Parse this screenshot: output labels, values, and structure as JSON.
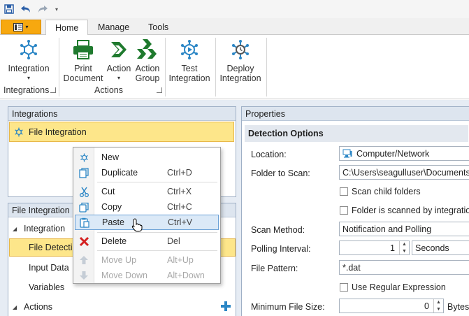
{
  "ribbon_tabs": [
    {
      "label": "Home",
      "active": true
    },
    {
      "label": "Manage",
      "active": false
    },
    {
      "label": "Tools",
      "active": false
    }
  ],
  "ribbon": {
    "integration": {
      "line1": "Integration",
      "dropdown": true
    },
    "integrations_group": "Integrations",
    "print": {
      "line1": "Print",
      "line2": "Document"
    },
    "action": {
      "line1": "Action",
      "dropdown": true
    },
    "action_group": {
      "line1": "Action",
      "line2": "Group"
    },
    "actions_group": "Actions",
    "test": {
      "line1": "Test",
      "line2": "Integration"
    },
    "deploy": {
      "line1": "Deploy",
      "line2": "Integration"
    }
  },
  "integrations_panel": {
    "title": "Integrations",
    "item": "File Integration"
  },
  "file_integration_panel": {
    "title": "File Integration",
    "tree": [
      {
        "label": "Integration",
        "level": 0,
        "expanded": true
      },
      {
        "label": "File Detection",
        "level": 1,
        "selected": true
      },
      {
        "label": "Input Data",
        "level": 1
      },
      {
        "label": "Variables",
        "level": 1
      },
      {
        "label": "Actions",
        "level": 0,
        "expanded": true
      }
    ]
  },
  "properties": {
    "title": "Properties",
    "section": "Detection Options",
    "location_label": "Location:",
    "location_value": "Computer/Network",
    "folder_label": "Folder to Scan:",
    "folder_value": "C:\\Users\\seagulluser\\Documents\\E",
    "scan_child": "Scan child folders",
    "folder_scanned": "Folder is scanned by integration",
    "scan_method_label": "Scan Method:",
    "scan_method_value": "Notification and Polling",
    "polling_label": "Polling Interval:",
    "polling_value": "1",
    "polling_unit": "Seconds",
    "pattern_label": "File Pattern:",
    "pattern_value": "*.dat",
    "regex_label": "Use Regular Expression",
    "min_size_label": "Minimum File Size:",
    "min_size_value": "0",
    "min_size_unit": "Bytes"
  },
  "context_menu": [
    {
      "label": "New",
      "shortcut": "",
      "icon": "integration-icon",
      "enabled": true
    },
    {
      "label": "Duplicate",
      "shortcut": "Ctrl+D",
      "icon": "duplicate-icon",
      "enabled": true
    },
    {
      "label": "Cut",
      "shortcut": "Ctrl+X",
      "icon": "scissors-icon",
      "enabled": true
    },
    {
      "label": "Copy",
      "shortcut": "Ctrl+C",
      "icon": "copy-icon",
      "enabled": true
    },
    {
      "label": "Paste",
      "shortcut": "Ctrl+V",
      "icon": "paste-icon",
      "enabled": true,
      "highlighted": true
    },
    {
      "label": "Delete",
      "shortcut": "Del",
      "icon": "delete-x-icon",
      "enabled": true
    },
    {
      "label": "Move Up",
      "shortcut": "Alt+Up",
      "icon": "arrow-up-icon",
      "enabled": false
    },
    {
      "label": "Move Down",
      "shortcut": "Alt+Down",
      "icon": "arrow-down-icon",
      "enabled": false
    }
  ],
  "colors": {
    "accent_orange": "#f7a80f",
    "selection_yellow": "#fde68a",
    "icon_blue": "#2b86c5",
    "icon_green": "#1f7a2e",
    "delete_red": "#d42020",
    "menu_highlight": "#dbe9f7"
  }
}
